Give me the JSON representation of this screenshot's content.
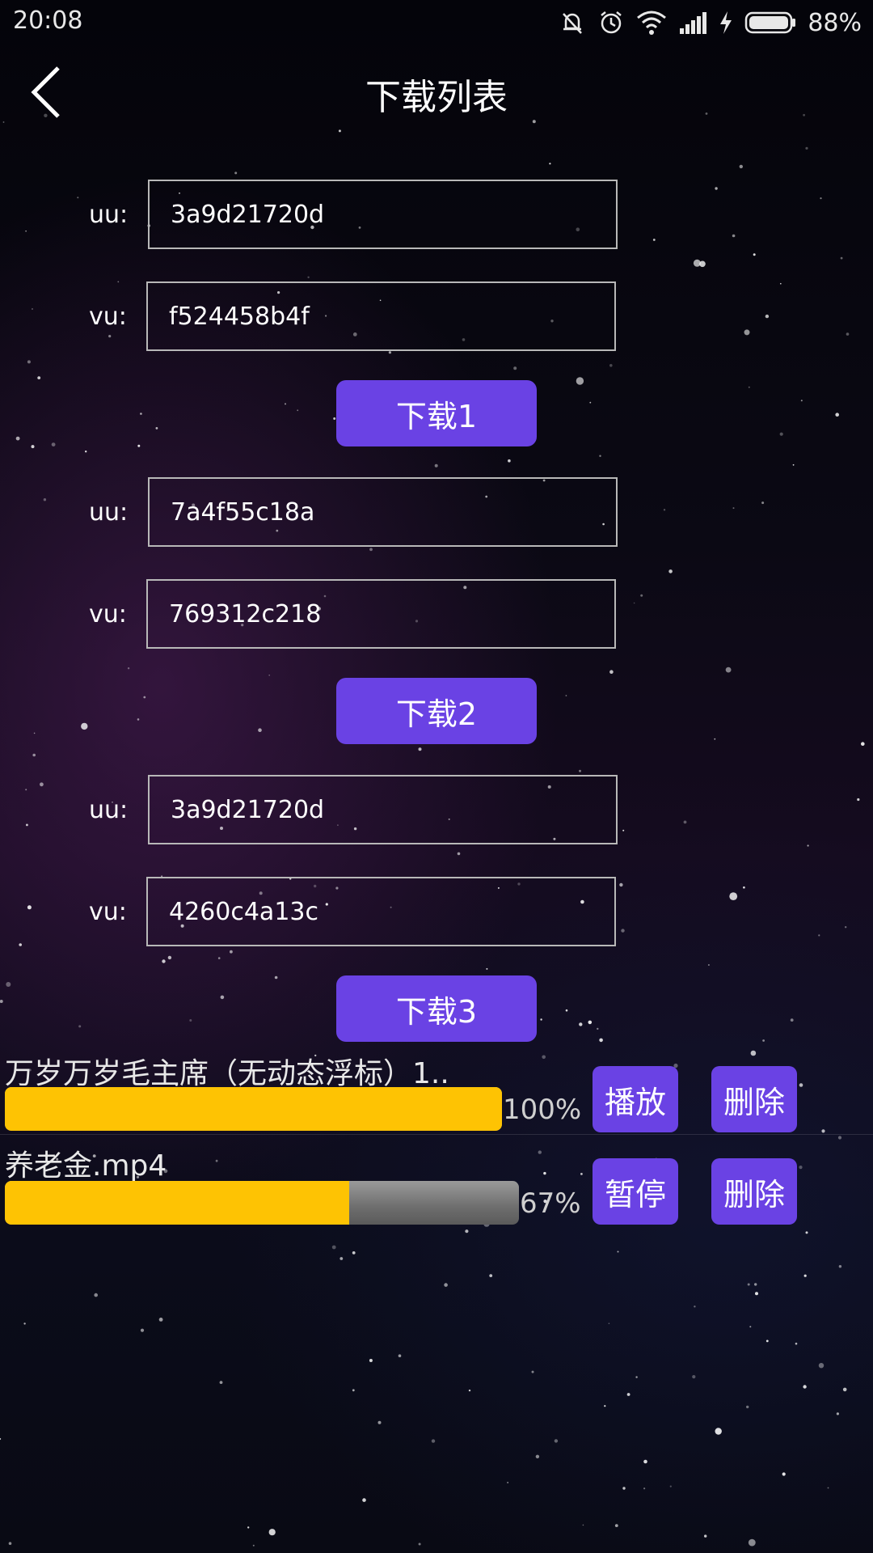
{
  "status_bar": {
    "time": "20:08",
    "battery": "88%",
    "icons": [
      "mute-icon",
      "alarm-icon",
      "wifi-icon",
      "signal-icon",
      "charging-icon",
      "battery-icon"
    ]
  },
  "header": {
    "title": "下载列表",
    "back_icon": "chevron-left-icon"
  },
  "forms": [
    {
      "uu_label": "uu:",
      "uu_value": "3a9d21720d",
      "vu_label": "vu:",
      "vu_value": "f524458b4f",
      "button": "下载1"
    },
    {
      "uu_label": "uu:",
      "uu_value": "7a4f55c18a",
      "vu_label": "vu:",
      "vu_value": "769312c218",
      "button": "下载2"
    },
    {
      "uu_label": "uu:",
      "uu_value": "3a9d21720d",
      "vu_label": "vu:",
      "vu_value": "4260c4a13c",
      "button": "下载3"
    }
  ],
  "downloads": [
    {
      "name": "万岁万岁毛主席（无动态浮标）1..",
      "progress": 100,
      "progress_text": "100%",
      "action": "播放",
      "delete": "删除"
    },
    {
      "name": "养老金.mp4",
      "progress": 67,
      "progress_text": "67%",
      "action": "暂停",
      "delete": "删除"
    }
  ],
  "colors": {
    "accent": "#6a42e4",
    "progress_fill": "#fec303",
    "progress_track": "#7a7a7a"
  }
}
